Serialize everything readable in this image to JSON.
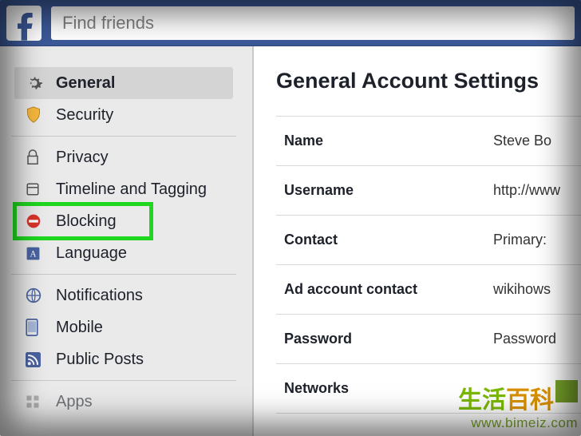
{
  "search": {
    "placeholder": "Find friends"
  },
  "sidebar": {
    "group1": [
      {
        "label": "General"
      },
      {
        "label": "Security"
      }
    ],
    "group2": [
      {
        "label": "Privacy"
      },
      {
        "label": "Timeline and Tagging"
      },
      {
        "label": "Blocking"
      },
      {
        "label": "Language"
      }
    ],
    "group3": [
      {
        "label": "Notifications"
      },
      {
        "label": "Mobile"
      },
      {
        "label": "Public Posts"
      }
    ],
    "group4": [
      {
        "label": "Apps"
      }
    ]
  },
  "main": {
    "title": "General Account Settings",
    "rows": [
      {
        "label": "Name",
        "value": "Steve Bo"
      },
      {
        "label": "Username",
        "value": "http://www"
      },
      {
        "label": "Contact",
        "value": "Primary: "
      },
      {
        "label": "Ad account contact",
        "value": "wikihows"
      },
      {
        "label": "Password",
        "value": "Password"
      },
      {
        "label": "Networks",
        "value": ""
      }
    ]
  },
  "watermark": {
    "cn1": "生活",
    "cn2": "百科",
    "url": "www.bimeiz.com"
  }
}
